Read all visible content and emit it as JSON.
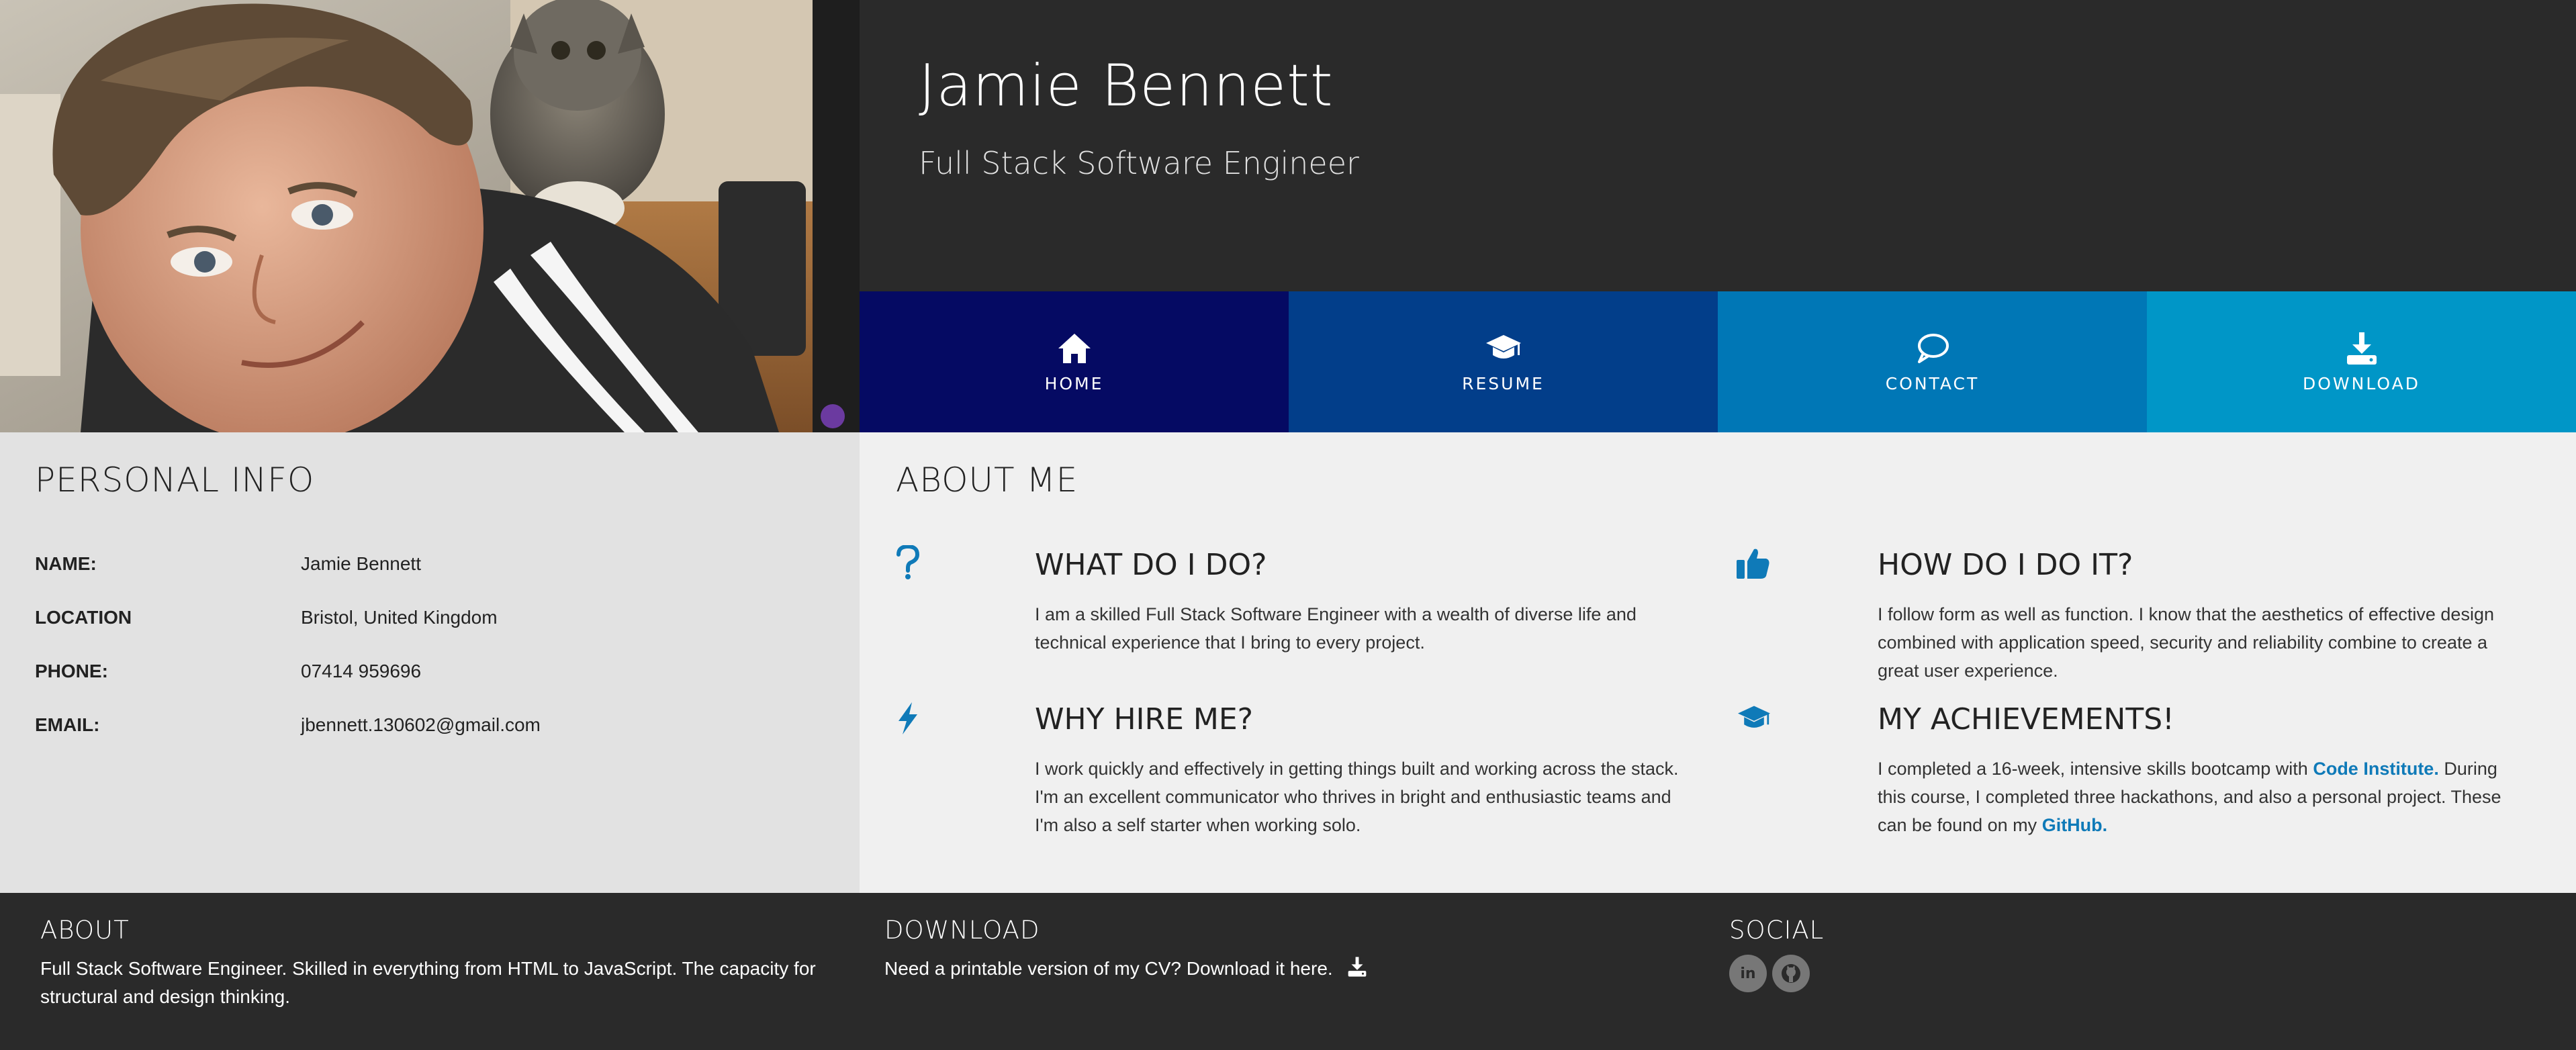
{
  "header": {
    "name": "Jamie Bennett",
    "title": "Full Stack Software Engineer",
    "background": "#2a2a2a"
  },
  "nav": [
    {
      "label": "HOME",
      "icon": "home-icon",
      "color": "#050a63"
    },
    {
      "label": "RESUME",
      "icon": "graduation-cap-icon",
      "color": "#023e8a"
    },
    {
      "label": "CONTACT",
      "icon": "speech-bubble-icon",
      "color": "#0077b6"
    },
    {
      "label": "DOWNLOAD",
      "icon": "download-icon",
      "color": "#0096c7"
    }
  ],
  "personal_info": {
    "heading": "PERSONAL INFO",
    "rows": [
      {
        "key": "NAME:",
        "value": "Jamie Bennett"
      },
      {
        "key": "LOCATION",
        "value": "Bristol, United Kingdom"
      },
      {
        "key": "PHONE:",
        "value": "07414 959696"
      },
      {
        "key": "EMAIL:",
        "value": "jbennett.130602@gmail.com"
      }
    ]
  },
  "about": {
    "heading": "ABOUT ME",
    "accent": "#0f7ab8",
    "features": {
      "what": {
        "icon": "question-icon",
        "title": "WHAT DO I DO?",
        "text": "I am a skilled Full Stack Software Engineer with a wealth of diverse life and technical experience that I bring to every project."
      },
      "how": {
        "icon": "thumbs-up-icon",
        "title": "HOW DO I DO IT?",
        "text": "I follow form as well as function. I know that the aesthetics of effective design combined with application speed, security and reliability combine to create a great user experience."
      },
      "why": {
        "icon": "lightning-icon",
        "title": "WHY HIRE ME?",
        "text": "I work quickly and effectively in getting things built and working across the stack. I'm an excellent communicator who thrives in bright and enthusiastic teams and I'm also a self starter when working solo."
      },
      "achievements": {
        "icon": "graduation-cap-icon",
        "title": "MY ACHIEVEMENTS!",
        "text_1": "I completed a 16-week, intensive skills bootcamp with",
        "link_1": "Code Institute.",
        "text_2": "During this course, I completed three hackathons, and also a personal project. These can be found on my",
        "link_2": "GitHub."
      }
    }
  },
  "footer": {
    "about_heading": "ABOUT",
    "about_text": "Full Stack Software Engineer. Skilled in everything from HTML to JavaScript. The capacity for structural and design thinking.",
    "download_heading": "DOWNLOAD",
    "download_text": "Need a printable version of my CV? Download it here.",
    "social_heading": "SOCIAL",
    "social": [
      {
        "label": "in",
        "icon": "linkedin-icon"
      },
      {
        "label": "",
        "icon": "github-icon"
      }
    ]
  }
}
